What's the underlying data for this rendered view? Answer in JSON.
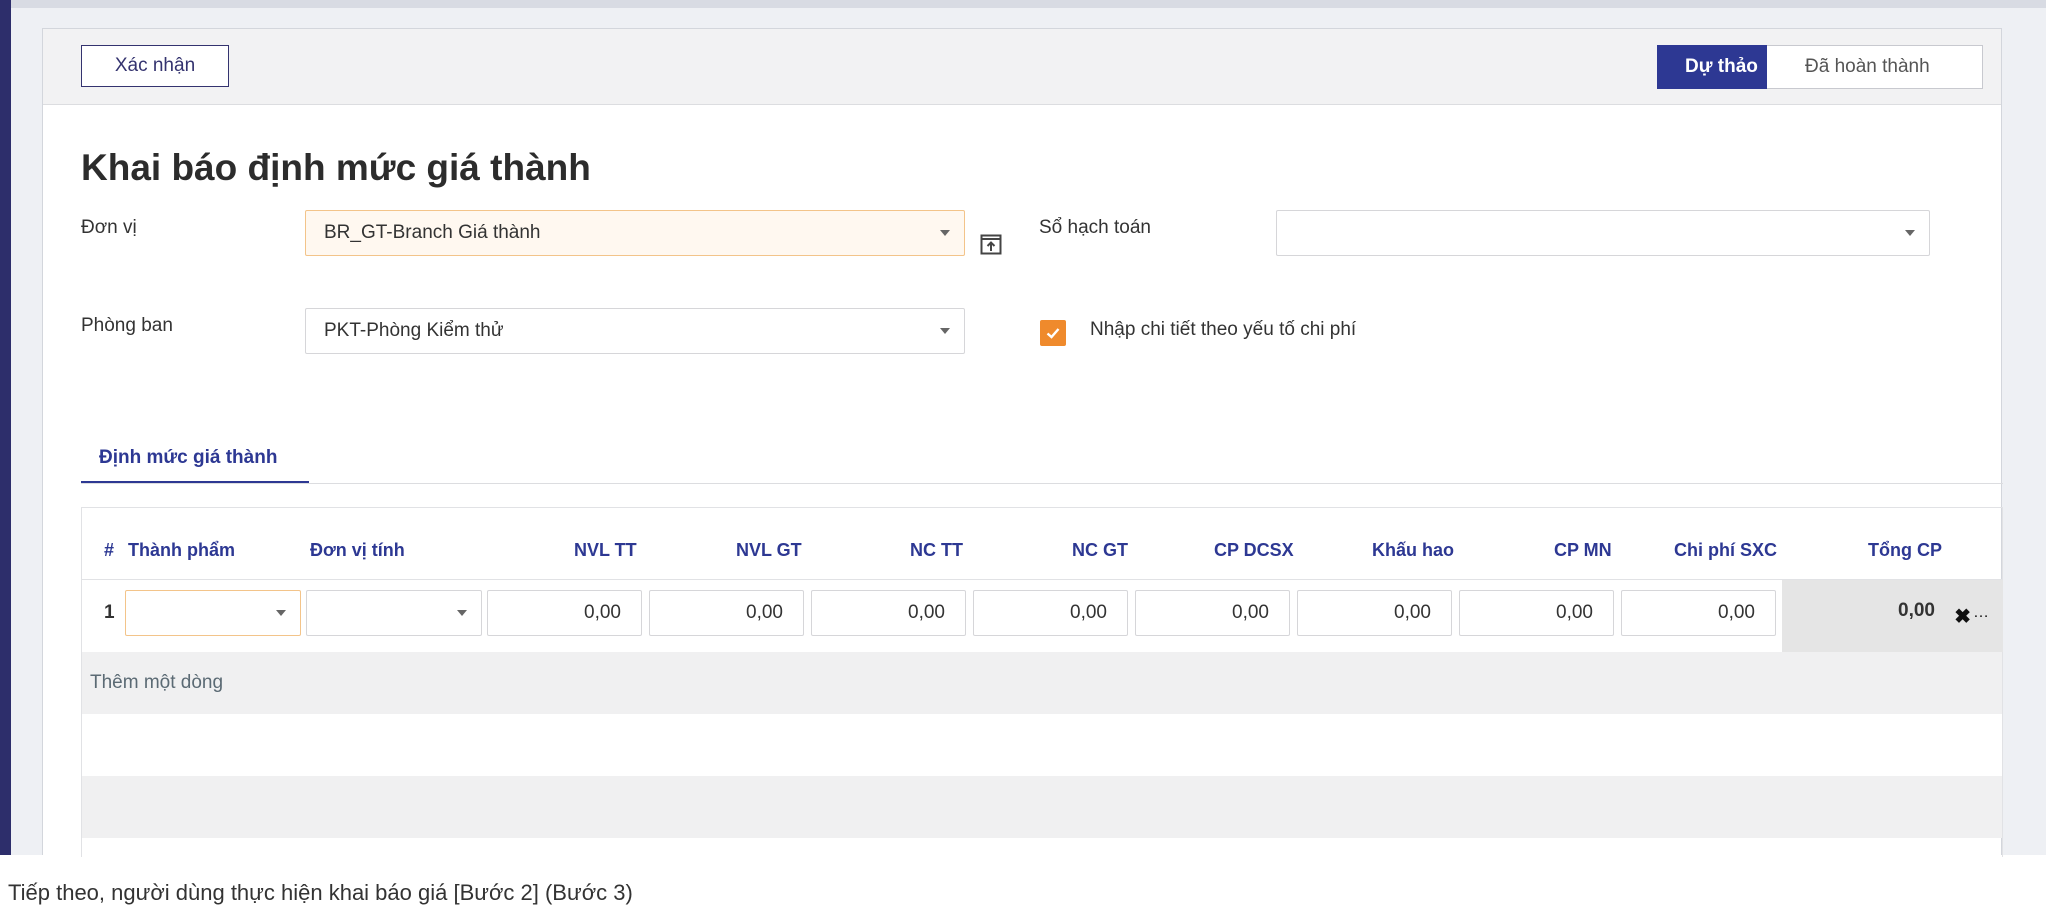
{
  "toolbar": {
    "confirm_label": "Xác nhận"
  },
  "stages": {
    "draft": "Dự thảo",
    "done": "Đã hoàn thành"
  },
  "form": {
    "title": "Khai báo định mức giá thành",
    "unit_label": "Đơn vị",
    "unit_value": "BR_GT-Branch Giá thành",
    "ledger_label": "Sổ hạch toán",
    "ledger_value": "",
    "dept_label": "Phòng ban",
    "dept_value": "PKT-Phòng Kiểm thử",
    "detail_checkbox_label": "Nhập chi tiết theo yếu tố chi phí",
    "detail_checked": true
  },
  "tabs": [
    {
      "label": "Định mức giá thành"
    }
  ],
  "table": {
    "headers": {
      "num": "#",
      "product": "Thành phẩm",
      "uom": "Đơn vị tính",
      "nvl_tt": "NVL TT",
      "nvl_gt": "NVL GT",
      "nc_tt": "NC TT",
      "nc_gt": "NC GT",
      "cp_dcsx": "CP DCSX",
      "khau_hao": "Khấu hao",
      "cp_mn": "CP MN",
      "cp_sxc": "Chi phí SXC",
      "tong_cp": "Tổng CP"
    },
    "rows": [
      {
        "num": "1",
        "product": "",
        "uom": "",
        "values": [
          "0,00",
          "0,00",
          "0,00",
          "0,00",
          "0,00",
          "0,00",
          "0,00",
          "0,00"
        ],
        "total": "0,00"
      }
    ],
    "add_row_label": "Thêm một dòng"
  },
  "footer": {
    "partial_text": "Tiếp theo, người dùng thực hiện khai báo giá [Bước 2] (Bước 3)"
  },
  "colors": {
    "accent": "#2d3893",
    "sidebar": "#2d2e6b",
    "checkbox": "#ef8a2c",
    "highlight_border": "#f3c48a"
  },
  "icons": [
    "external-link-icon",
    "chevron-down-icon",
    "check-icon",
    "close-icon"
  ]
}
